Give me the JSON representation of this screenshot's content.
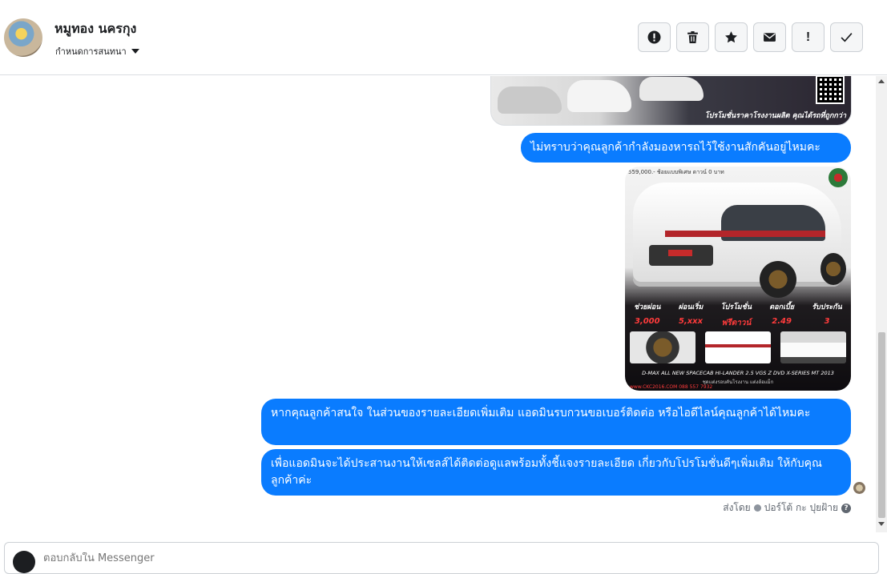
{
  "header": {
    "contact_name": "หมูทอง นครกุง",
    "conversation_menu": "กำหนดการสนทนา",
    "toolbar": [
      {
        "name": "spam-button",
        "icon": "alert-circle-icon"
      },
      {
        "name": "delete-button",
        "icon": "trash-icon"
      },
      {
        "name": "star-button",
        "icon": "star-icon"
      },
      {
        "name": "mark-unread-button",
        "icon": "envelope-icon"
      },
      {
        "name": "important-button",
        "icon": "exclamation-icon",
        "label": "!"
      },
      {
        "name": "done-button",
        "icon": "check-icon"
      }
    ]
  },
  "messages": {
    "top_image_caption": "โปรโมชั่นราคาโรงงานผลิต คุณได้รถที่ถูกกว่า",
    "msg1": "ไม่ทราบว่าคุณลูกค้ากำลังมองหารถไว้ใช้งานสักคันอยู่ไหมคะ",
    "image_card": {
      "price_head": "559,000.- ช้อยแบบพิเศษ ดาวน์ 0 บาท",
      "specs": [
        {
          "label": "ช่วยผ่อน",
          "value": "3,000"
        },
        {
          "label": "ผ่อนเริ่ม",
          "value": "5,xxx"
        },
        {
          "label": "โปรโมชั่น",
          "value": "ฟรีดาวน์"
        },
        {
          "label": "ดอกเบี้ย",
          "value": "2.49"
        },
        {
          "label": "รับประกัน",
          "value": "3"
        }
      ],
      "model_line": "D-MAX ALL NEW SPACECAB HI-LANDER 2.5 VGS Z DVD X-SERIES MT 2013",
      "sub_line": "ชุดแต่งรอบคันโรงงาน แต่งล้อแม็ก",
      "contact_line": "www.CKC2016.COM 088 557 7932"
    },
    "msg2": "หากคุณลูกค้าสนใจ ในส่วนของรายละเอียดเพิ่มเติม แอดมินรบกวนขอเบอร์ติดต่อ หรือไอดีไลน์คุณลูกค้าได้ไหมคะ",
    "msg3": "เพื่อแอดมินจะได้ประสานงานให้เซลส์ได้ติดต่อดูแลพร้อมทั้งชี้แจงรายละเอียด เกี่ยวกับโปรโมชั่นดีๆเพิ่มเติม ให้กับคุณลูกค้าค่ะ",
    "sent_by_prefix": "ส่งโดย",
    "sent_by_name": "ปอร์โต้ กะ ปุยฝ้าย"
  },
  "composer": {
    "placeholder": "ตอบกลับใน Messenger"
  }
}
